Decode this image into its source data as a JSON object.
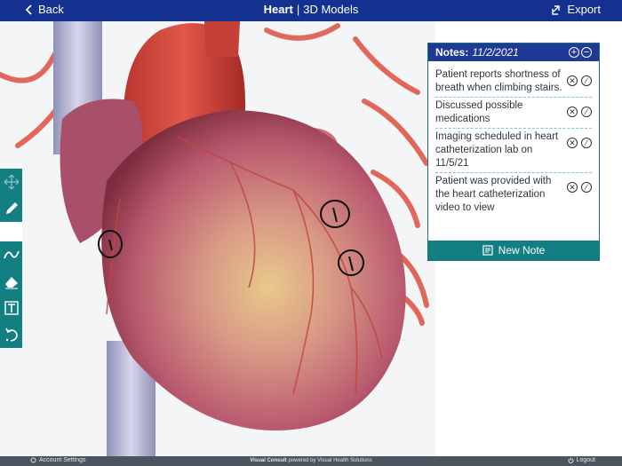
{
  "header": {
    "back_label": "Back",
    "title_bold": "Heart",
    "separator": "|",
    "title_rest": "3D Models",
    "export_label": "Export"
  },
  "viewer": {
    "subject": "3D heart model"
  },
  "toolbar": {
    "tools": [
      "move-icon",
      "pencil-icon",
      "freehand-icon",
      "eraser-icon",
      "text-icon",
      "undo-icon"
    ]
  },
  "notes": {
    "label": "Notes:",
    "date": "11/2/2021",
    "items": [
      {
        "text": "Patient reports shortness of breath when climbing stairs."
      },
      {
        "text": "Discussed possible medications"
      },
      {
        "text": "Imaging scheduled in heart catheterization lab on 11/5/21"
      },
      {
        "text": "Patient was provided with the heart catheterization video to view"
      }
    ],
    "new_note_label": "New Note"
  },
  "footer": {
    "account_label": "Account Settings",
    "brand_bold": "Visual Consult",
    "brand_rest": "powered by Visual Health Solutions",
    "logout_label": "Logout"
  },
  "colors": {
    "header_bg": "#14318f",
    "teal": "#137f83",
    "footer_bg": "#4b5560"
  }
}
